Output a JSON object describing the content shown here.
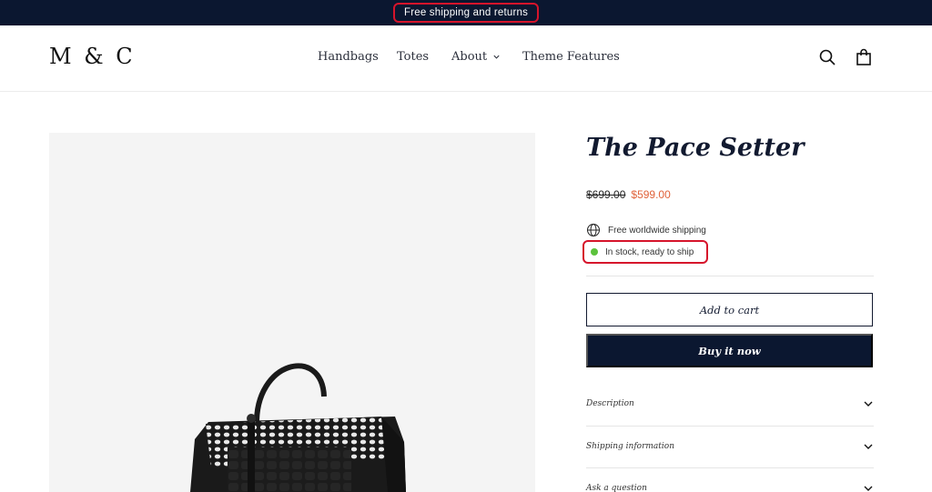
{
  "announcement": {
    "text": "Free shipping and returns"
  },
  "header": {
    "logo": "M & C",
    "nav": [
      {
        "label": "Handbags"
      },
      {
        "label": "Totes"
      },
      {
        "label": "About",
        "has_dropdown": true
      },
      {
        "label": "Theme Features"
      }
    ],
    "icons": [
      "search-icon",
      "cart-icon"
    ]
  },
  "product": {
    "title": "The Pace Setter",
    "compare_price": "$699.00",
    "price": "$599.00",
    "shipping_info": "Free worldwide shipping",
    "stock_status": "In stock, ready to ship",
    "add_to_cart": "Add to cart",
    "buy_now": "Buy it now",
    "accordions": [
      {
        "label": "Description"
      },
      {
        "label": "Shipping information"
      },
      {
        "label": "Ask a question"
      }
    ]
  },
  "colors": {
    "announcement_bg": "#0b1730",
    "sale_price": "#e0623a",
    "stock_dot": "#5cc23c",
    "highlight_outline": "#d6142b"
  }
}
